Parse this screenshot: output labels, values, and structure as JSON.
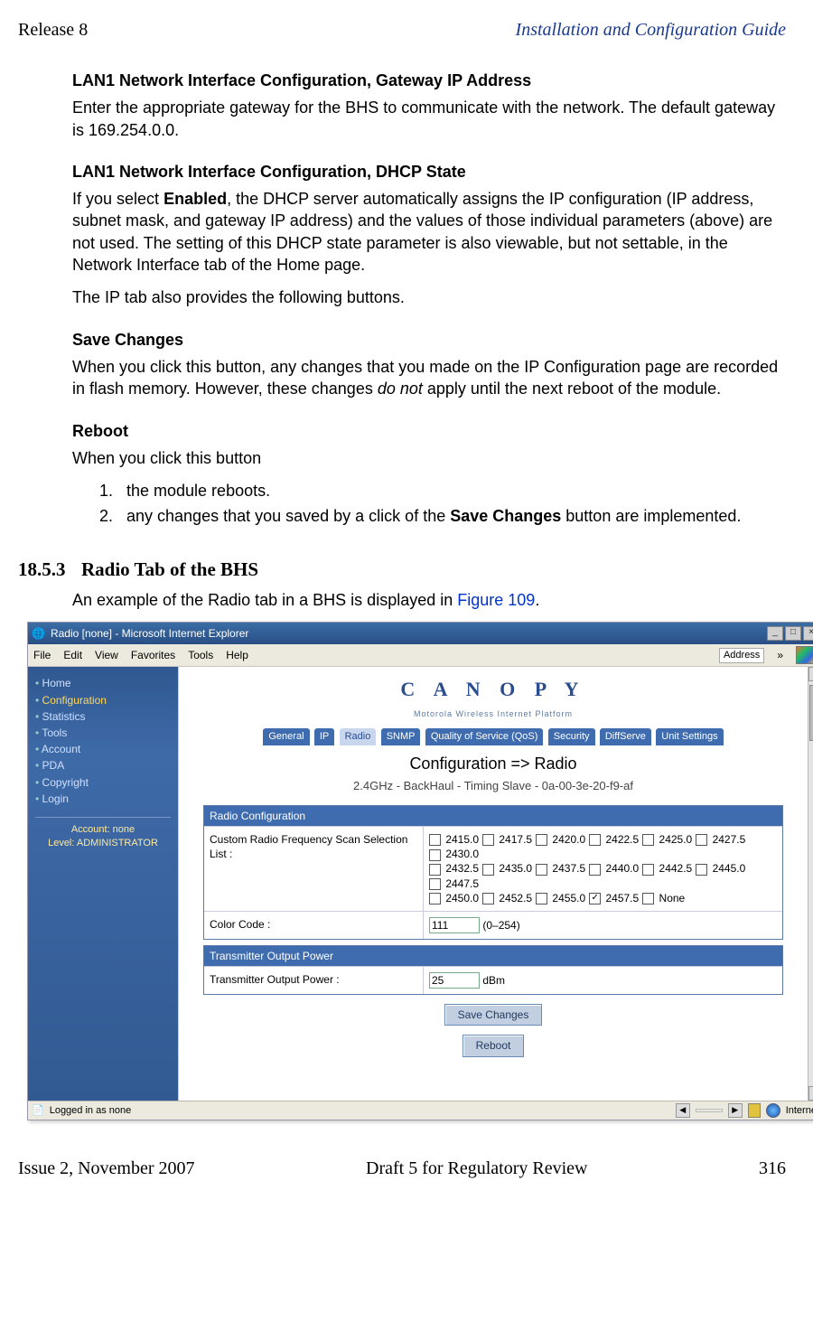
{
  "header": {
    "left": "Release 8",
    "right": "Installation and Configuration Guide"
  },
  "sections": {
    "gw_h": "LAN1 Network Interface Configuration, Gateway IP Address",
    "gw_p": "Enter the appropriate gateway for the BHS to communicate with the network. The default gateway is 169.254.0.0.",
    "dhcp_h": "LAN1 Network Interface Configuration, DHCP State",
    "dhcp_p_pre": "If you select ",
    "dhcp_bold": "Enabled",
    "dhcp_p_post": ", the DHCP server automatically assigns the IP configuration (IP address, subnet mask, and gateway IP address) and the values of those individual parameters (above) are not used. The setting of this DHCP state parameter is also viewable, but not settable, in the Network Interface tab of the Home page.",
    "iptab": "The IP tab also provides the following buttons.",
    "save_h": "Save Changes",
    "save_p_pre": "When you click this button, any changes that you made on the IP Configuration page are recorded in flash memory. However, these changes ",
    "save_italic": "do not",
    "save_p_post": " apply until the next reboot of the module.",
    "reboot_h": "Reboot",
    "reboot_p": "When you click this button",
    "li1": "the module reboots.",
    "li2_pre": "any changes that you saved by a click of the ",
    "li2_bold": "Save Changes",
    "li2_post": " button are implemented.",
    "sect_num": "18.5.3",
    "sect_title": "Radio Tab of the BHS",
    "sect_p_pre": "An example of the Radio tab in a BHS is displayed in ",
    "sect_link": "Figure 109",
    "sect_p_post": "."
  },
  "browser": {
    "title": "Radio [none] - Microsoft Internet Explorer",
    "menus": [
      "File",
      "Edit",
      "View",
      "Favorites",
      "Tools",
      "Help"
    ],
    "addr_label": "Address",
    "chevron": "»",
    "logo": "C A N O P Y",
    "logo_sub": "Motorola Wireless Internet Platform",
    "tabs": [
      "General",
      "IP",
      "Radio",
      "SNMP",
      "Quality of Service (QoS)",
      "Security",
      "DiffServe",
      "Unit Settings"
    ],
    "tab_selected_index": 2,
    "page_title": "Configuration => Radio",
    "device_line": "2.4GHz - BackHaul - Timing Slave - 0a-00-3e-20-f9-af",
    "panel1_hdr": "Radio Configuration",
    "row1_label": "Custom Radio Frequency Scan Selection List :",
    "freqs_row1": [
      "2415.0",
      "2417.5",
      "2420.0",
      "2422.5",
      "2425.0",
      "2427.5"
    ],
    "freq_break1": "2430.0",
    "freqs_row2": [
      "2432.5",
      "2435.0",
      "2437.5",
      "2440.0",
      "2442.5",
      "2445.0"
    ],
    "freq_break2": "2447.5",
    "freqs_row3": [
      "2450.0",
      "2452.5",
      "2455.0",
      "2457.5",
      "None"
    ],
    "freq_checked": "2457.5",
    "row2_label": "Color Code :",
    "row2_value": "111",
    "row2_hint": "(0–254)",
    "panel2_hdr": "Transmitter Output Power",
    "row3_label": "Transmitter Output Power :",
    "row3_value": "25",
    "row3_unit": "dBm",
    "btn_save": "Save Changes",
    "btn_reboot": "Reboot",
    "sidebar": [
      "Home",
      "Configuration",
      "Statistics",
      "Tools",
      "Account",
      "PDA",
      "Copyright",
      "Login"
    ],
    "sidebar_acct1": "Account: none",
    "sidebar_acct2": "Level: ADMINISTRATOR",
    "status_left": "Logged in as none",
    "status_zone": "Internet"
  },
  "footer": {
    "left": "Issue 2, November 2007",
    "center": "Draft 5 for Regulatory Review",
    "right": "316"
  }
}
